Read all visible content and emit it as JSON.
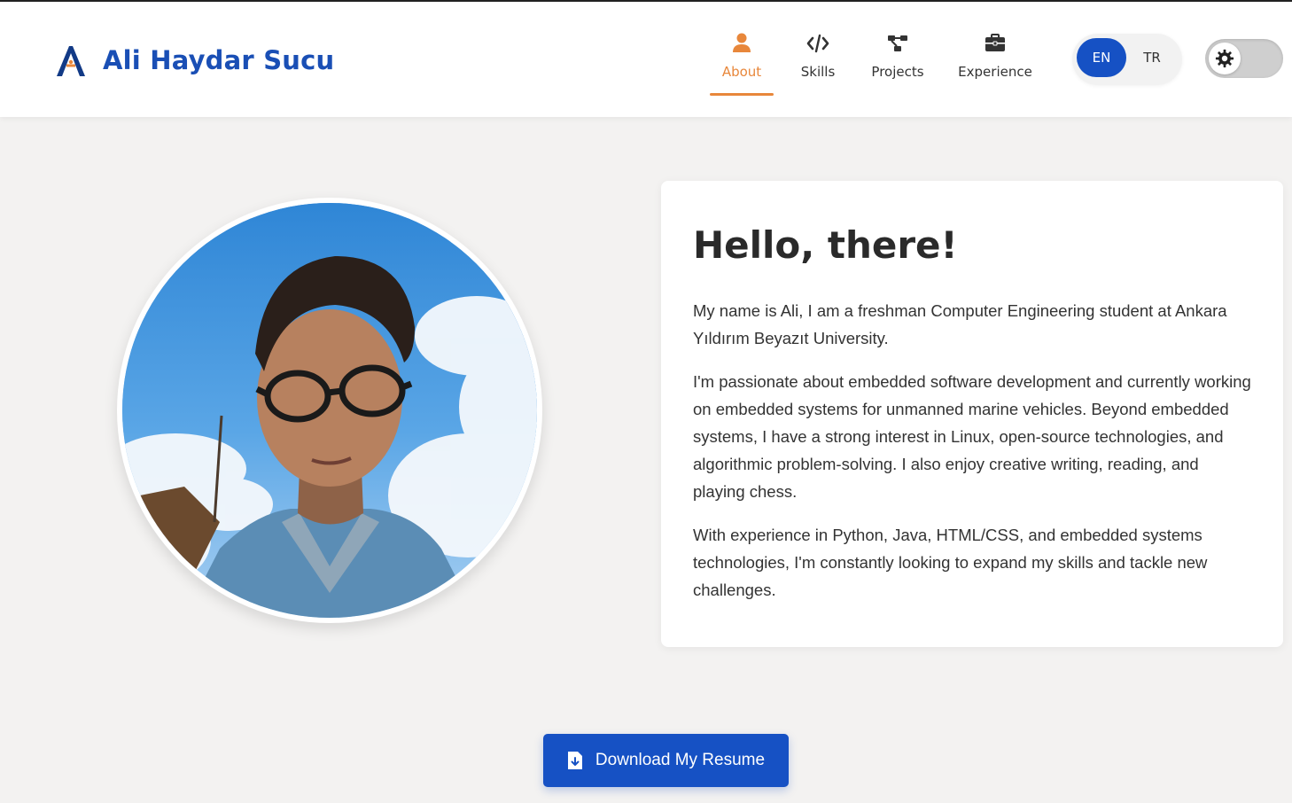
{
  "header": {
    "brand_name": "Ali Haydar Sucu",
    "logo_icon": "logo-a-icon"
  },
  "nav": {
    "items": [
      {
        "label": "About",
        "icon": "user-icon",
        "active": true
      },
      {
        "label": "Skills",
        "icon": "code-icon",
        "active": false
      },
      {
        "label": "Projects",
        "icon": "project-diagram-icon",
        "active": false
      },
      {
        "label": "Experience",
        "icon": "briefcase-icon",
        "active": false
      }
    ]
  },
  "language": {
    "options": [
      "EN",
      "TR"
    ],
    "selected": "EN"
  },
  "theme": {
    "icon": "gear-icon",
    "mode": "light"
  },
  "about": {
    "heading": "Hello, there!",
    "paragraphs": [
      "My name is Ali, I am a freshman Computer Engineering student at Ankara Yıldırım Beyazıt University.",
      "I'm passionate about embedded software development and currently working on embedded systems for unmanned marine vehicles. Beyond embedded systems, I have a strong interest in Linux, open-source technologies, and algorithmic problem-solving. I also enjoy creative writing, reading, and playing chess.",
      "With experience in Python, Java, HTML/CSS, and embedded systems technologies, I'm constantly looking to expand my skills and tackle new challenges."
    ]
  },
  "cta": {
    "download_label": "Download My Resume",
    "icon": "file-download-icon"
  },
  "colors": {
    "primary": "#1651c4",
    "accent": "#e8873b",
    "brand_text": "#1a4fb5",
    "background": "#f3f2f1"
  }
}
